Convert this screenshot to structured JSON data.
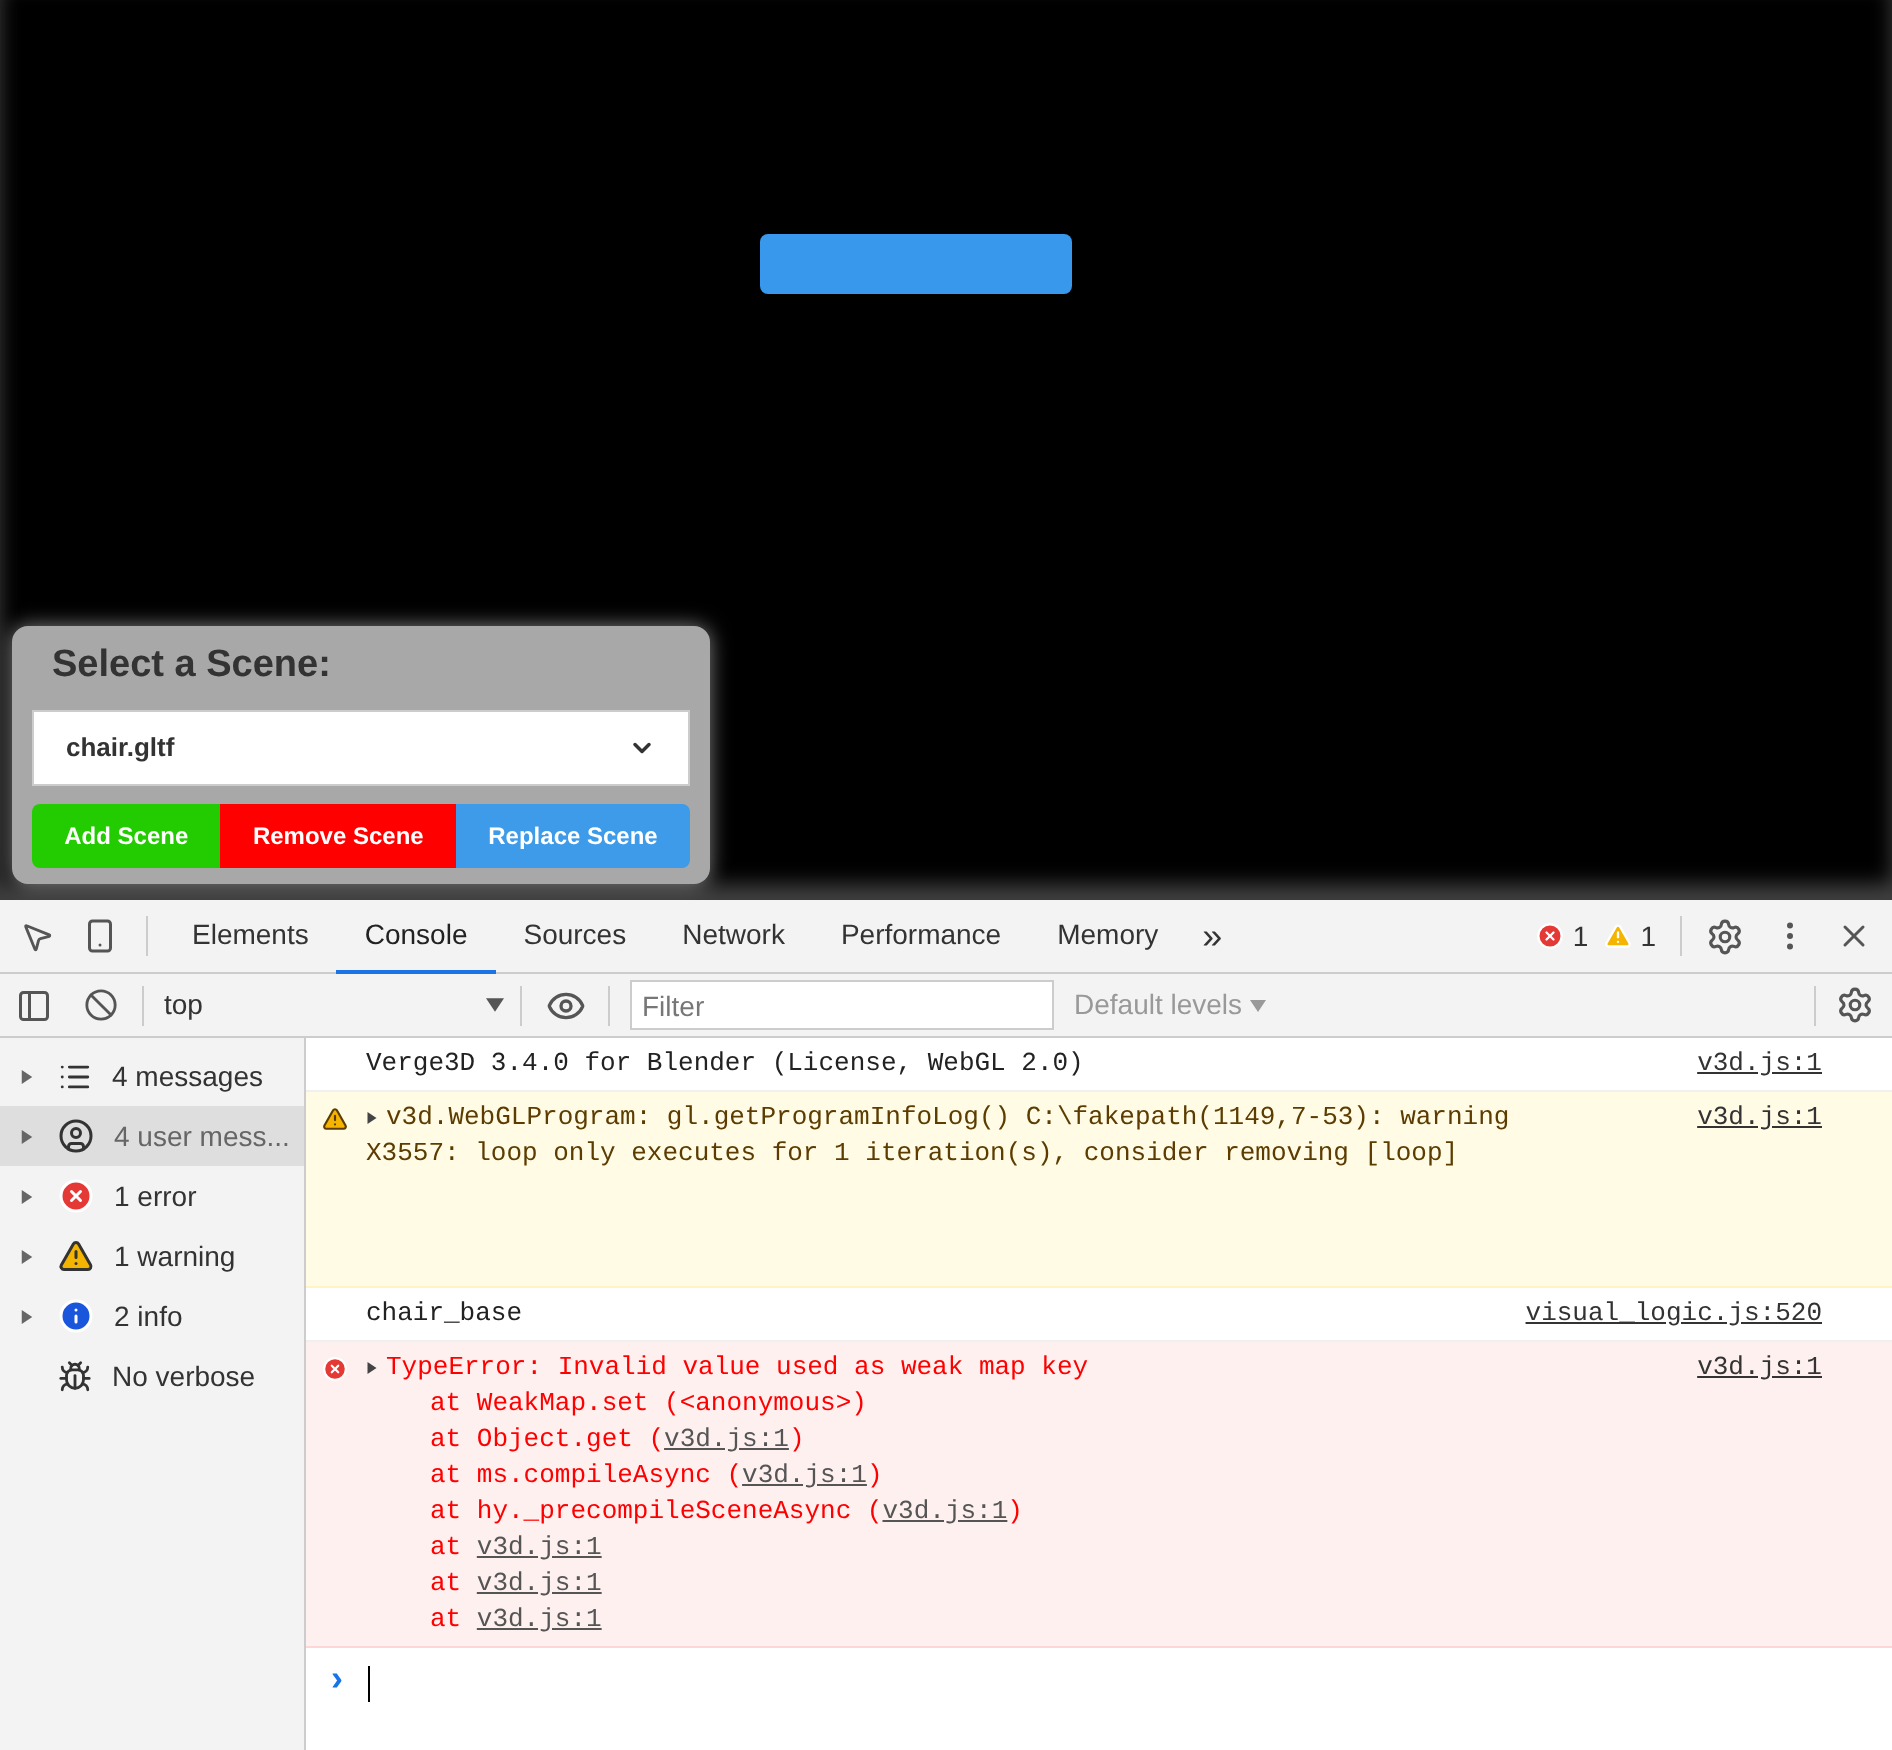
{
  "scene_panel": {
    "title": "Select a Scene:",
    "select_value": "chair.gltf",
    "buttons": [
      {
        "label": "Add Scene",
        "color": "#22cc00"
      },
      {
        "label": "Remove Scene",
        "color": "#ff0000"
      },
      {
        "label": "Replace Scene",
        "color": "#3d9be9"
      }
    ]
  },
  "devtools": {
    "tabs": [
      {
        "label": "Elements",
        "selected": false
      },
      {
        "label": "Console",
        "selected": true
      },
      {
        "label": "Sources",
        "selected": false
      },
      {
        "label": "Network",
        "selected": false
      },
      {
        "label": "Performance",
        "selected": false
      },
      {
        "label": "Memory",
        "selected": false
      }
    ],
    "more_tabs": "»",
    "error_count": "1",
    "warning_count": "1"
  },
  "console_toolbar": {
    "context": "top",
    "filter_placeholder": "Filter",
    "levels": "Default levels"
  },
  "sidebar": {
    "items": [
      {
        "kind": "list",
        "label": "4 messages",
        "selected": false,
        "expandable": true
      },
      {
        "kind": "user",
        "label": "4 user mess...",
        "selected": true,
        "expandable": true
      },
      {
        "kind": "error",
        "label": "1 error",
        "selected": false,
        "expandable": true
      },
      {
        "kind": "warning",
        "label": "1 warning",
        "selected": false,
        "expandable": true
      },
      {
        "kind": "info",
        "label": "2 info",
        "selected": false,
        "expandable": true
      },
      {
        "kind": "verbose",
        "label": "No verbose",
        "selected": false,
        "expandable": false
      }
    ]
  },
  "messages": [
    {
      "kind": "log",
      "expandable": false,
      "lines": [
        "Verge3D 3.4.0 for Blender (License, WebGL 2.0)"
      ],
      "source": "v3d.js:1"
    },
    {
      "kind": "warning",
      "expandable": true,
      "lines": [
        "v3d.WebGLProgram: gl.getProgramInfoLog() C:\\fakepath(1149,7-53): warning",
        "X3557: loop only executes for 1 iteration(s), consider removing [loop]"
      ],
      "source": "v3d.js:1"
    },
    {
      "kind": "log",
      "expandable": false,
      "lines": [
        "chair_base"
      ],
      "source": "visual_logic.js:520"
    },
    {
      "kind": "error",
      "expandable": true,
      "lines": [
        "TypeError: Invalid value used as weak map key"
      ],
      "source": "v3d.js:1",
      "stack": [
        {
          "prefix": "at WeakMap.set (<anonymous>)"
        },
        {
          "prefix": "at Object.get (",
          "link": "v3d.js:1",
          "suffix": ")"
        },
        {
          "prefix": "at ms.compileAsync (",
          "link": "v3d.js:1",
          "suffix": ")"
        },
        {
          "prefix": "at hy._precompileSceneAsync (",
          "link": "v3d.js:1",
          "suffix": ")"
        },
        {
          "prefix": "at ",
          "link": "v3d.js:1"
        },
        {
          "prefix": "at ",
          "link": "v3d.js:1"
        },
        {
          "prefix": "at ",
          "link": "v3d.js:1"
        }
      ]
    }
  ],
  "prompt": "›"
}
